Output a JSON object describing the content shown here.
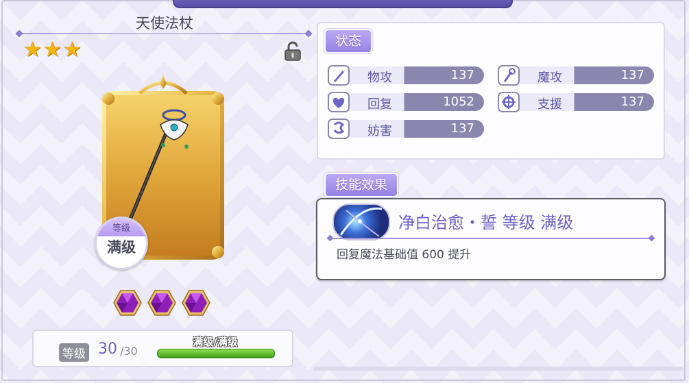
{
  "item": {
    "name": "天使法杖",
    "stars": 3,
    "level_badge_label": "等级",
    "level_badge_value": "满级",
    "gems": 3
  },
  "level": {
    "label": "等级",
    "current": "30",
    "max": "/30",
    "bar_text": "满级/满级",
    "progress": 1.0
  },
  "status": {
    "title": "状态",
    "stats": [
      {
        "label": "物攻",
        "value": "137",
        "icon": "sword-icon"
      },
      {
        "label": "魔攻",
        "value": "137",
        "icon": "wand-icon"
      },
      {
        "label": "回复",
        "value": "1052",
        "icon": "heal-icon"
      },
      {
        "label": "支援",
        "value": "137",
        "icon": "support-icon"
      },
      {
        "label": "妨害",
        "value": "137",
        "icon": "debuff-icon"
      }
    ]
  },
  "skill": {
    "section_title": "技能效果",
    "name": "净白治愈・誓 等级 满级",
    "description": "回复魔法基础值 600 提升"
  },
  "colors": {
    "accent": "#9684e4",
    "stat_value_bg": "#8b86ad",
    "level_bar": "#3f9e1a",
    "star": "#f5b50d"
  }
}
